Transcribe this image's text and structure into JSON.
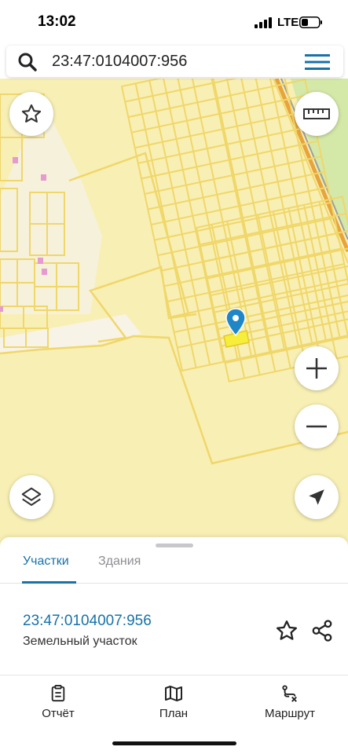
{
  "status_bar": {
    "time": "13:02",
    "network": "LTE"
  },
  "search": {
    "value": "23:47:0104007:956"
  },
  "map": {
    "colors": {
      "background": "#f8efb4",
      "parcel_line": "#f0d76a",
      "highlight": "#f6ee3a",
      "pin": "#1f86c8",
      "road_orange": "#e8a33a",
      "green": "#d4e8a8"
    }
  },
  "tabs": [
    {
      "label": "Участки",
      "active": true
    },
    {
      "label": "Здания",
      "active": false
    }
  ],
  "parcel": {
    "id": "23:47:0104007:956",
    "type": "Земельный участок"
  },
  "bottom_nav": [
    {
      "label": "Отчёт",
      "icon": "report-icon"
    },
    {
      "label": "План",
      "icon": "map-plan-icon"
    },
    {
      "label": "Маршрут",
      "icon": "route-icon"
    }
  ],
  "accent_color": "#1772a8"
}
